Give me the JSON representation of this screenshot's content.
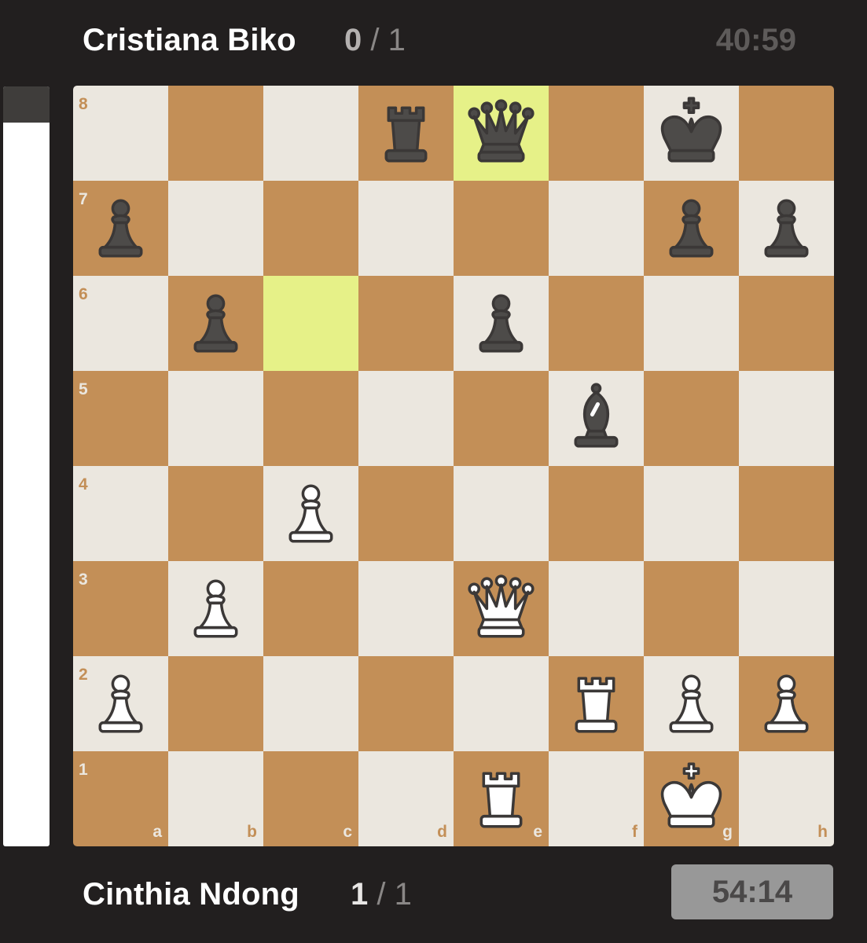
{
  "top_player": {
    "name": "Cristiana Biko",
    "score": "0",
    "score_total": "/ 1",
    "clock": "40:59"
  },
  "bottom_player": {
    "name": "Cinthia Ndong",
    "score": "1",
    "score_total": "/ 1",
    "clock": "54:14"
  },
  "eval_bar": {
    "black_fraction": 0.048
  },
  "board": {
    "files": [
      "a",
      "b",
      "c",
      "d",
      "e",
      "f",
      "g",
      "h"
    ],
    "ranks": [
      "8",
      "7",
      "6",
      "5",
      "4",
      "3",
      "2",
      "1"
    ],
    "highlighted_squares": [
      "e8",
      "c6"
    ],
    "pieces": [
      {
        "square": "d8",
        "color": "black",
        "type": "rook"
      },
      {
        "square": "e8",
        "color": "black",
        "type": "queen"
      },
      {
        "square": "g8",
        "color": "black",
        "type": "king"
      },
      {
        "square": "a7",
        "color": "black",
        "type": "pawn"
      },
      {
        "square": "g7",
        "color": "black",
        "type": "pawn"
      },
      {
        "square": "h7",
        "color": "black",
        "type": "pawn"
      },
      {
        "square": "b6",
        "color": "black",
        "type": "pawn"
      },
      {
        "square": "e6",
        "color": "black",
        "type": "pawn"
      },
      {
        "square": "f5",
        "color": "black",
        "type": "bishop"
      },
      {
        "square": "c4",
        "color": "white",
        "type": "pawn"
      },
      {
        "square": "b3",
        "color": "white",
        "type": "pawn"
      },
      {
        "square": "e3",
        "color": "white",
        "type": "queen"
      },
      {
        "square": "a2",
        "color": "white",
        "type": "pawn"
      },
      {
        "square": "f2",
        "color": "white",
        "type": "rook"
      },
      {
        "square": "g2",
        "color": "white",
        "type": "pawn"
      },
      {
        "square": "h2",
        "color": "white",
        "type": "pawn"
      },
      {
        "square": "e1",
        "color": "white",
        "type": "rook"
      },
      {
        "square": "g1",
        "color": "white",
        "type": "king"
      }
    ]
  },
  "colors": {
    "light_square": "#ebe7df",
    "dark_square": "#c38f57",
    "highlight": "#e6f188",
    "white_piece_fill": "#ffffff",
    "black_piece_fill": "#4d4b49",
    "piece_outline": "#3b3837"
  }
}
